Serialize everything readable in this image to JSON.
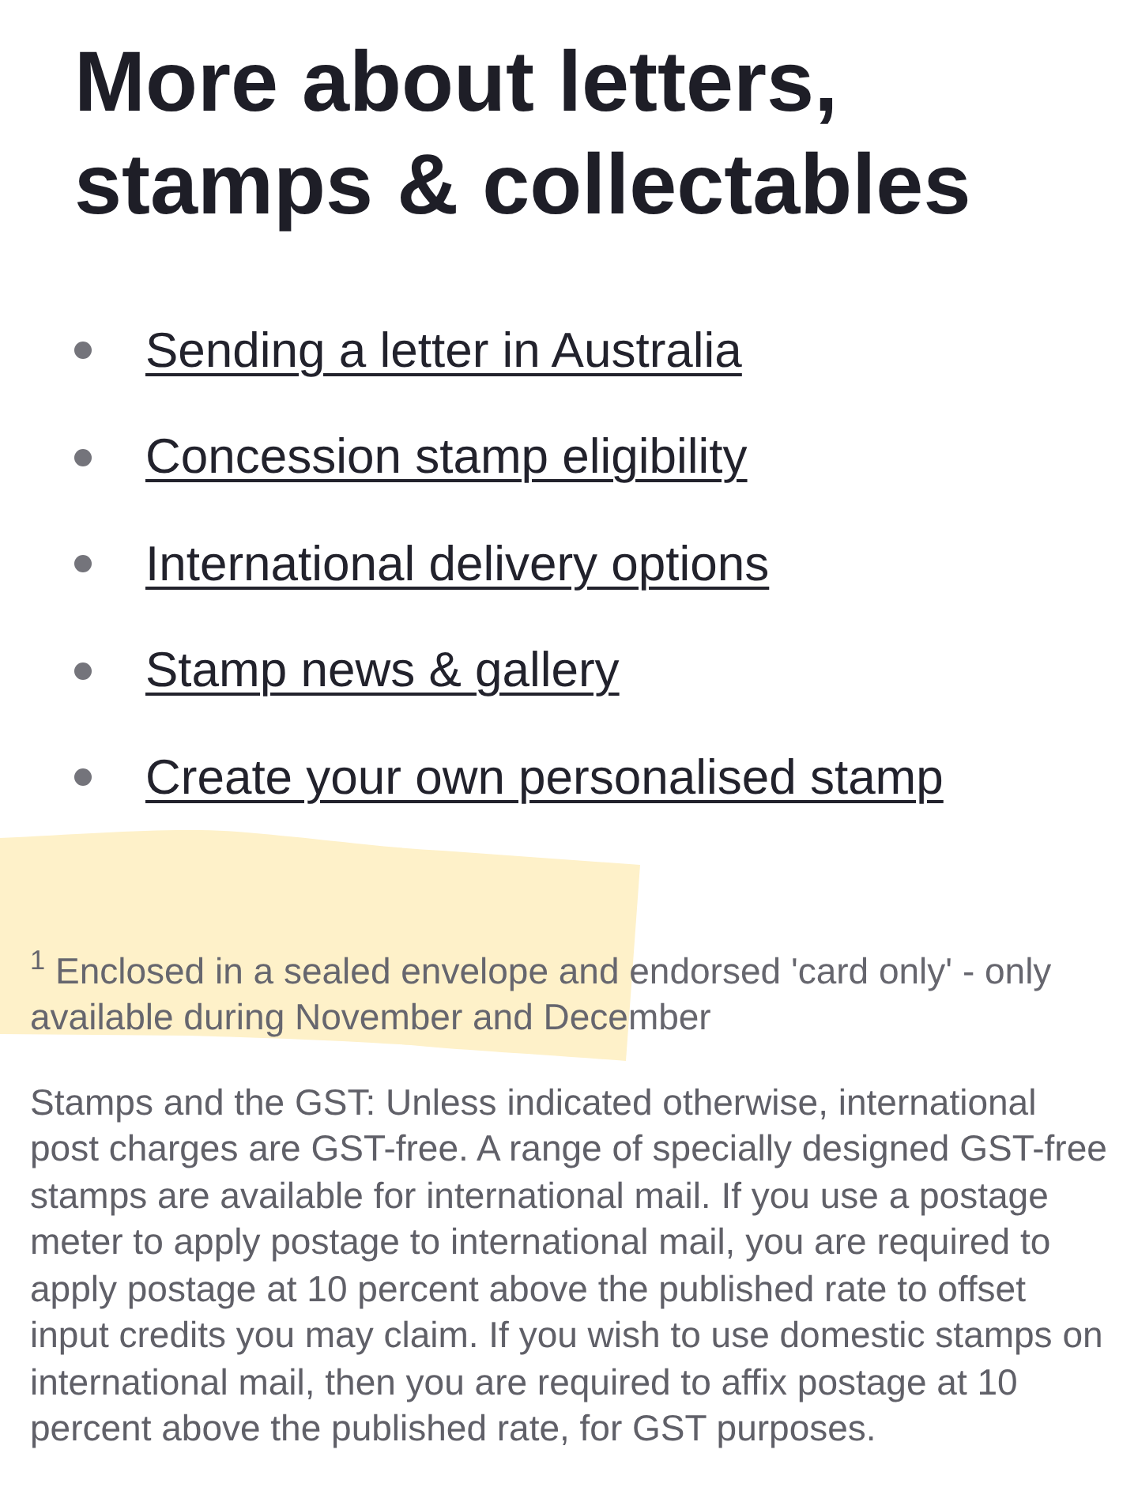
{
  "heading": "More about letters, stamps & collectables",
  "links": [
    "Sending a letter in Australia",
    "Concession stamp eligibility",
    "International delivery options",
    "Stamp news & gallery",
    "Create your own personalised stamp"
  ],
  "footnote": "$^{1}$ Enclosed in a sealed envelope and endorsed 'card only' - only available during November and December",
  "gst_note": "Stamps and the GST: Unless indicated otherwise, international post charges are GST-free. A range of specially designed GST-free stamps are available for international mail. If you use a postage meter to apply postage to international mail, you are required to apply postage at 10 percent above the published rate to offset input credits you may claim. If you wish to use domestic stamps on international mail, then you are required to affix postage at 10 percent above the published rate, for GST purposes."
}
